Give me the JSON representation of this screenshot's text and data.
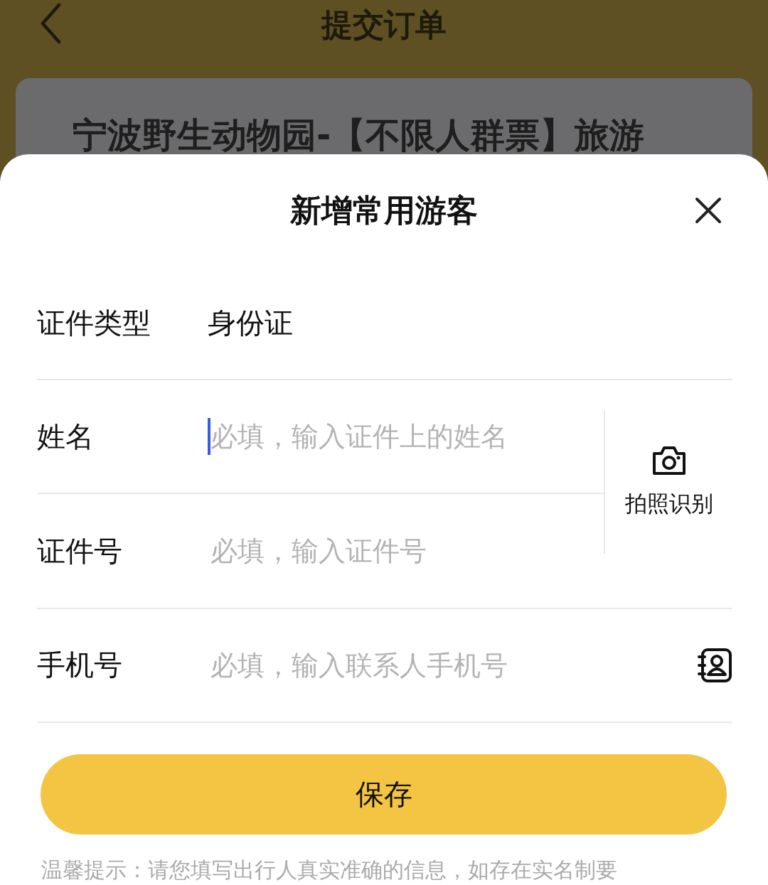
{
  "header": {
    "title": "提交订单"
  },
  "product_card": {
    "title": "宁波野生动物园-【不限人群票】旅游"
  },
  "sheet": {
    "title": "新增常用游客",
    "fields": [
      {
        "label": "证件类型",
        "kind": "value",
        "value": "身份证"
      },
      {
        "label": "姓名",
        "kind": "input",
        "placeholder": "必填，输入证件上的姓名",
        "focused": true
      },
      {
        "label": "证件号",
        "kind": "input",
        "placeholder": "必填，输入证件号",
        "focused": false
      },
      {
        "label": "手机号",
        "kind": "input",
        "placeholder": "必填，输入联系人手机号",
        "focused": false,
        "contact_picker": true
      }
    ],
    "scan": {
      "label": "拍照识别"
    },
    "save": "保存",
    "tip": "温馨提示：请您填写出行人真实准确的信息，如存在实名制要"
  }
}
